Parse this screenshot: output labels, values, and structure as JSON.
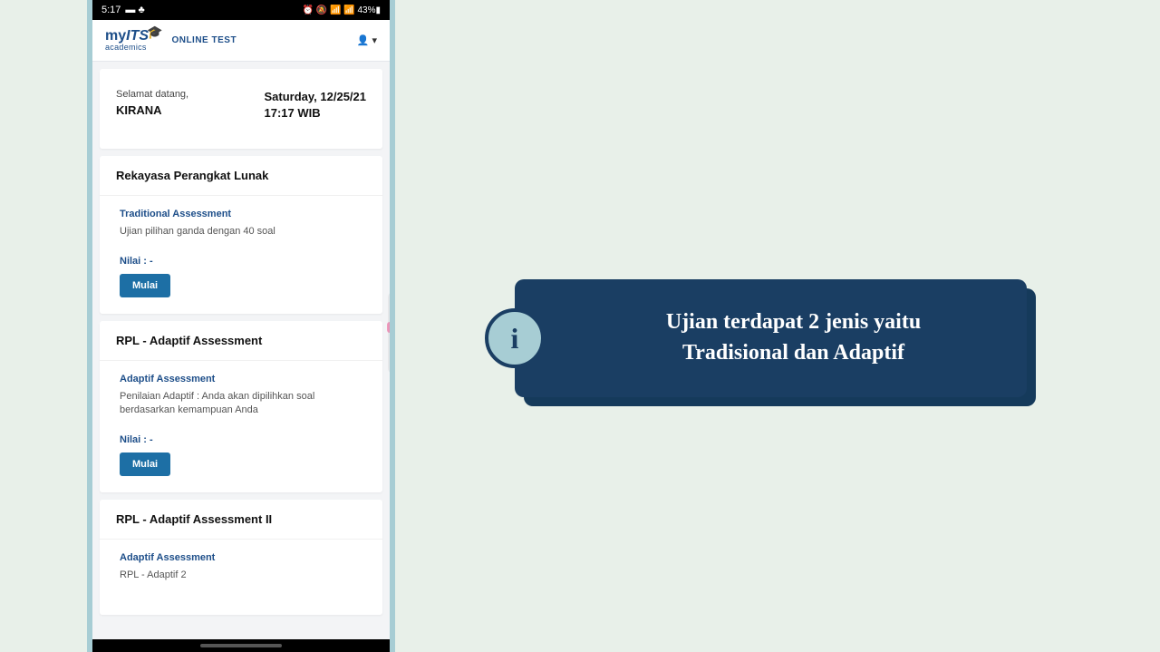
{
  "status": {
    "time": "5:17",
    "left_icons": "▬ ♣",
    "right_icons": "⏰ 🔕 📶 📶 43%▮"
  },
  "header": {
    "logo_my": "my",
    "logo_its": "ITS",
    "logo_acad": "academics",
    "logo_cap": "🎓",
    "online_test": "ONLINE TEST",
    "user_caret": "👤 ▾"
  },
  "welcome": {
    "greet": "Selamat datang,",
    "name": "KIRANA",
    "date": "Saturday, 12/25/21",
    "time": "17:17 WIB"
  },
  "sections": [
    {
      "title": "Rekayasa Perangkat Lunak",
      "assess_title": "Traditional Assessment",
      "assess_desc": "Ujian pilihan ganda dengan 40 soal",
      "nilai": "Nilai : -",
      "button": "Mulai"
    },
    {
      "title": "RPL - Adaptif Assessment",
      "assess_title": "Adaptif Assessment",
      "assess_desc": "Penilaian Adaptif : Anda akan dipilihkan soal berdasarkan kemampuan Anda",
      "nilai": "Nilai : -",
      "button": "Mulai"
    },
    {
      "title": "RPL - Adaptif Assessment II",
      "assess_title": "Adaptif Assessment",
      "assess_desc": "RPL - Adaptif 2",
      "nilai": "",
      "button": ""
    }
  ],
  "info": {
    "line1": "Ujian terdapat 2 jenis yaitu",
    "line2": "Tradisional dan Adaptif",
    "icon": "i"
  }
}
